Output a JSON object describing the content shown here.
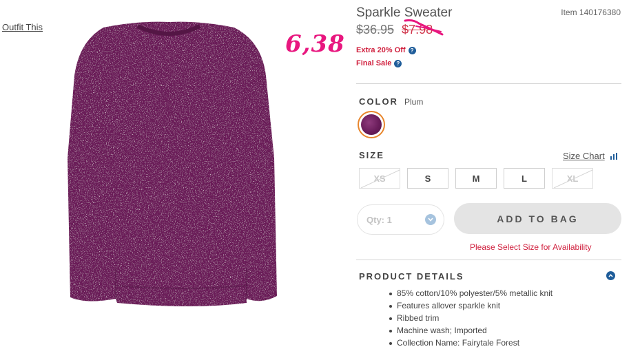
{
  "outfit_link": "Outfit This",
  "annotation": "6,38",
  "product": {
    "title": "Sparkle Sweater",
    "item_number": "Item 140176380",
    "price_original": "$36.95",
    "price_sale": "$7.98",
    "promo_extra": "Extra 20% Off",
    "promo_final": "Final Sale",
    "help_glyph": "?"
  },
  "color": {
    "label": "COLOR",
    "value": "Plum",
    "swatch_color": "#6a1d5b"
  },
  "size": {
    "label": "SIZE",
    "chart_link": "Size Chart",
    "options": [
      "XS",
      "S",
      "M",
      "L",
      "XL"
    ],
    "unavailable": [
      "XS",
      "XL"
    ]
  },
  "quantity": {
    "label": "Qty: 1"
  },
  "add_to_bag": "ADD TO BAG",
  "availability_msg": "Please Select Size for Availability",
  "details": {
    "label": "PRODUCT DETAILS",
    "items": [
      "85% cotton/10% polyester/5% metallic knit",
      "Features allover sparkle knit",
      "Ribbed trim",
      "Machine wash; Imported",
      "Collection Name: Fairytale Forest"
    ]
  },
  "colors": {
    "accent_red": "#d0203e",
    "annotation_pink": "#e8177f",
    "info_blue": "#1f5d9a",
    "swatch_ring": "#e8862d"
  }
}
